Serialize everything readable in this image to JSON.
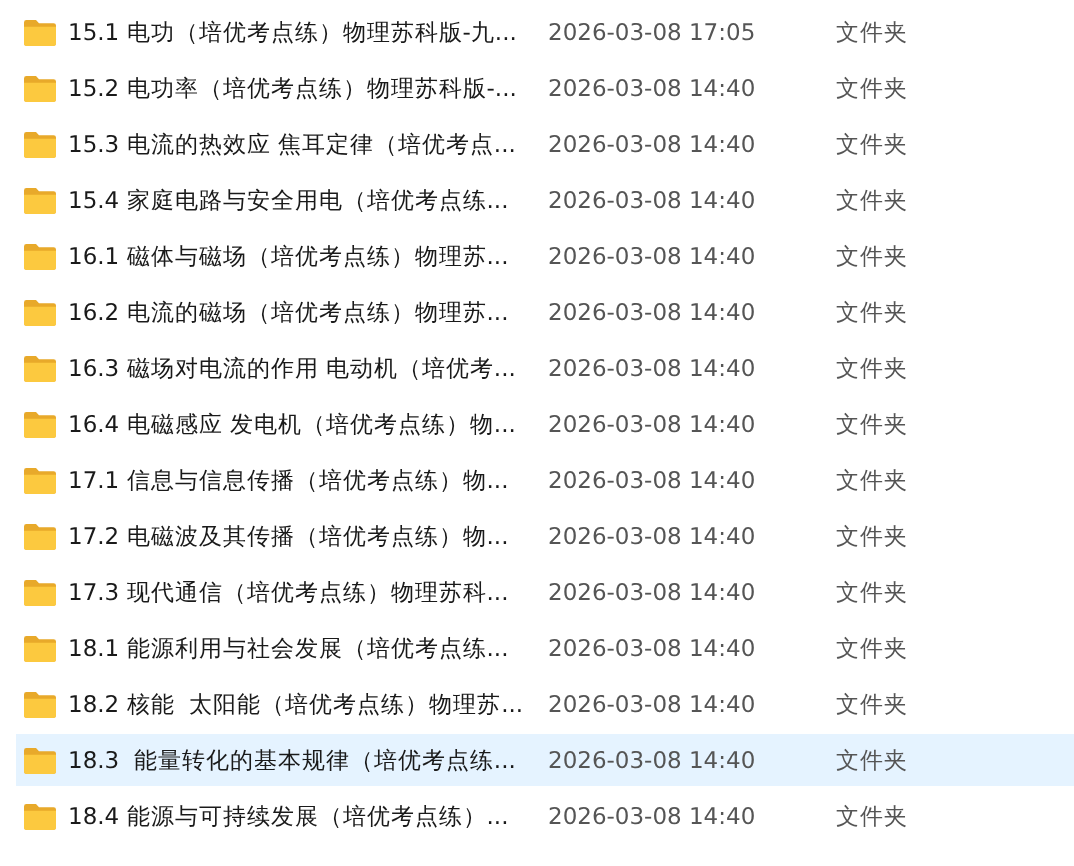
{
  "rows": [
    {
      "name": "15.1 电功（培优考点练）物理苏科版-九...",
      "modified": "2026-03-08 17:05",
      "type": "文件夹",
      "selected": false
    },
    {
      "name": "15.2 电功率（培优考点练）物理苏科版-...",
      "modified": "2026-03-08 14:40",
      "type": "文件夹",
      "selected": false
    },
    {
      "name": "15.3 电流的热效应 焦耳定律（培优考点...",
      "modified": "2026-03-08 14:40",
      "type": "文件夹",
      "selected": false
    },
    {
      "name": "15.4 家庭电路与安全用电（培优考点练...",
      "modified": "2026-03-08 14:40",
      "type": "文件夹",
      "selected": false
    },
    {
      "name": "16.1 磁体与磁场（培优考点练）物理苏...",
      "modified": "2026-03-08 14:40",
      "type": "文件夹",
      "selected": false
    },
    {
      "name": "16.2 电流的磁场（培优考点练）物理苏...",
      "modified": "2026-03-08 14:40",
      "type": "文件夹",
      "selected": false
    },
    {
      "name": "16.3 磁场对电流的作用 电动机（培优考...",
      "modified": "2026-03-08 14:40",
      "type": "文件夹",
      "selected": false
    },
    {
      "name": "16.4 电磁感应 发电机（培优考点练）物...",
      "modified": "2026-03-08 14:40",
      "type": "文件夹",
      "selected": false
    },
    {
      "name": "17.1 信息与信息传播（培优考点练）物...",
      "modified": "2026-03-08 14:40",
      "type": "文件夹",
      "selected": false
    },
    {
      "name": "17.2 电磁波及其传播（培优考点练）物...",
      "modified": "2026-03-08 14:40",
      "type": "文件夹",
      "selected": false
    },
    {
      "name": "17.3 现代通信（培优考点练）物理苏科...",
      "modified": "2026-03-08 14:40",
      "type": "文件夹",
      "selected": false
    },
    {
      "name": "18.1 能源利用与社会发展（培优考点练...",
      "modified": "2026-03-08 14:40",
      "type": "文件夹",
      "selected": false
    },
    {
      "name": "18.2 核能  太阳能（培优考点练）物理苏...",
      "modified": "2026-03-08 14:40",
      "type": "文件夹",
      "selected": false
    },
    {
      "name": "18.3  能量转化的基本规律（培优考点练...",
      "modified": "2026-03-08 14:40",
      "type": "文件夹",
      "selected": true
    },
    {
      "name": "18.4 能源与可持续发展（培优考点练）...",
      "modified": "2026-03-08 14:40",
      "type": "文件夹",
      "selected": false
    }
  ]
}
